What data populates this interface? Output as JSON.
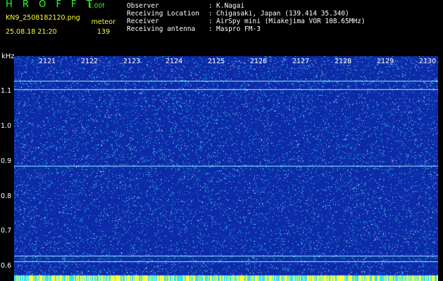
{
  "header": {
    "app_title": "H R O F F T",
    "version": "1.00f",
    "filename": "KN9_2508182120.png",
    "datetime": "25.08.18 21:20",
    "meteor_label": "meteor",
    "meteor_count": "139"
  },
  "info": [
    {
      "key": "Observer",
      "value": "K.Nagai"
    },
    {
      "key": "Receiving Location",
      "value": "Chigasaki, Japan (139.414 35.340)"
    },
    {
      "key": "Receiver",
      "value": "AirSpy mini (Miakejima VOR 108.65MHz)"
    },
    {
      "key": "Receiving antenna",
      "value": "Maspro FM-3"
    }
  ],
  "plot": {
    "y_unit": "kHz",
    "y_ticks": [
      "1.1",
      "1.0",
      "0.9",
      "0.8",
      "0.7",
      "0.6"
    ],
    "x_ticks": [
      "2121",
      "2122",
      "2123",
      "2124",
      "2125",
      "2126",
      "2127",
      "2128",
      "2129",
      "2130"
    ],
    "ylim": [
      0.57,
      1.19
    ],
    "line_freqs": [
      1.12,
      1.095,
      0.875,
      0.618,
      0.603
    ],
    "colors": {
      "background": "#0d2aa8",
      "noise": "#35e0ff",
      "bright": "#ffff40",
      "lines": "#8ef7ff"
    }
  }
}
